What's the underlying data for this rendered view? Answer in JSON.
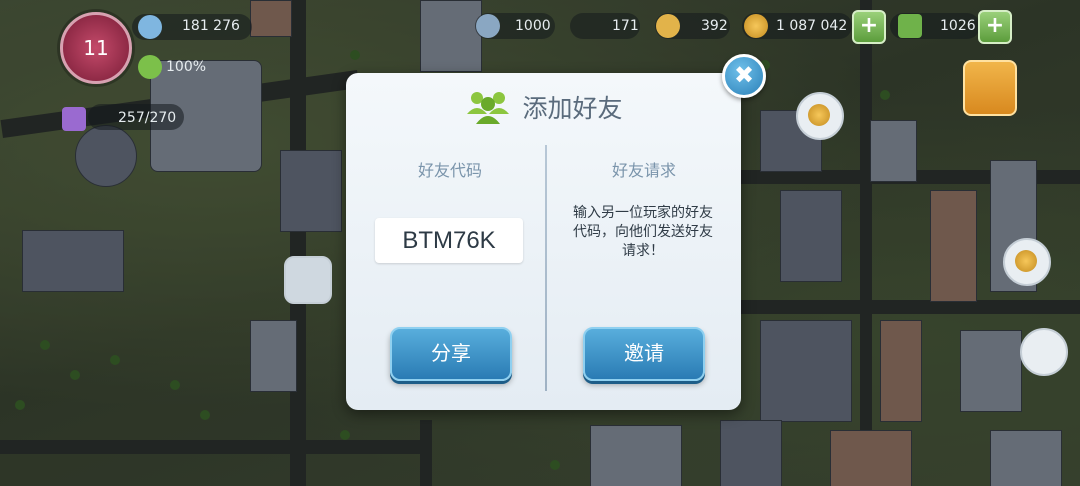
{
  "hud": {
    "level": "11",
    "population": "181 276",
    "happiness": "100%",
    "storage": "257/270",
    "resource_1": "1000",
    "resource_2": "171",
    "keys": "392",
    "simoleons": "1 087 042",
    "simcash": "1026"
  },
  "dialog": {
    "title": "添加好友",
    "left": {
      "heading": "好友代码",
      "code": "BTM76K",
      "button": "分享"
    },
    "right": {
      "heading": "好友请求",
      "description": "输入另一位玩家的好友代码，向他们发送好友请求！",
      "button": "邀请"
    },
    "close_glyph": "✖"
  },
  "colors": {
    "button_blue": "#2a7bb4",
    "title_gray": "#5a6b7c",
    "accent_green": "#5c9d3c"
  }
}
